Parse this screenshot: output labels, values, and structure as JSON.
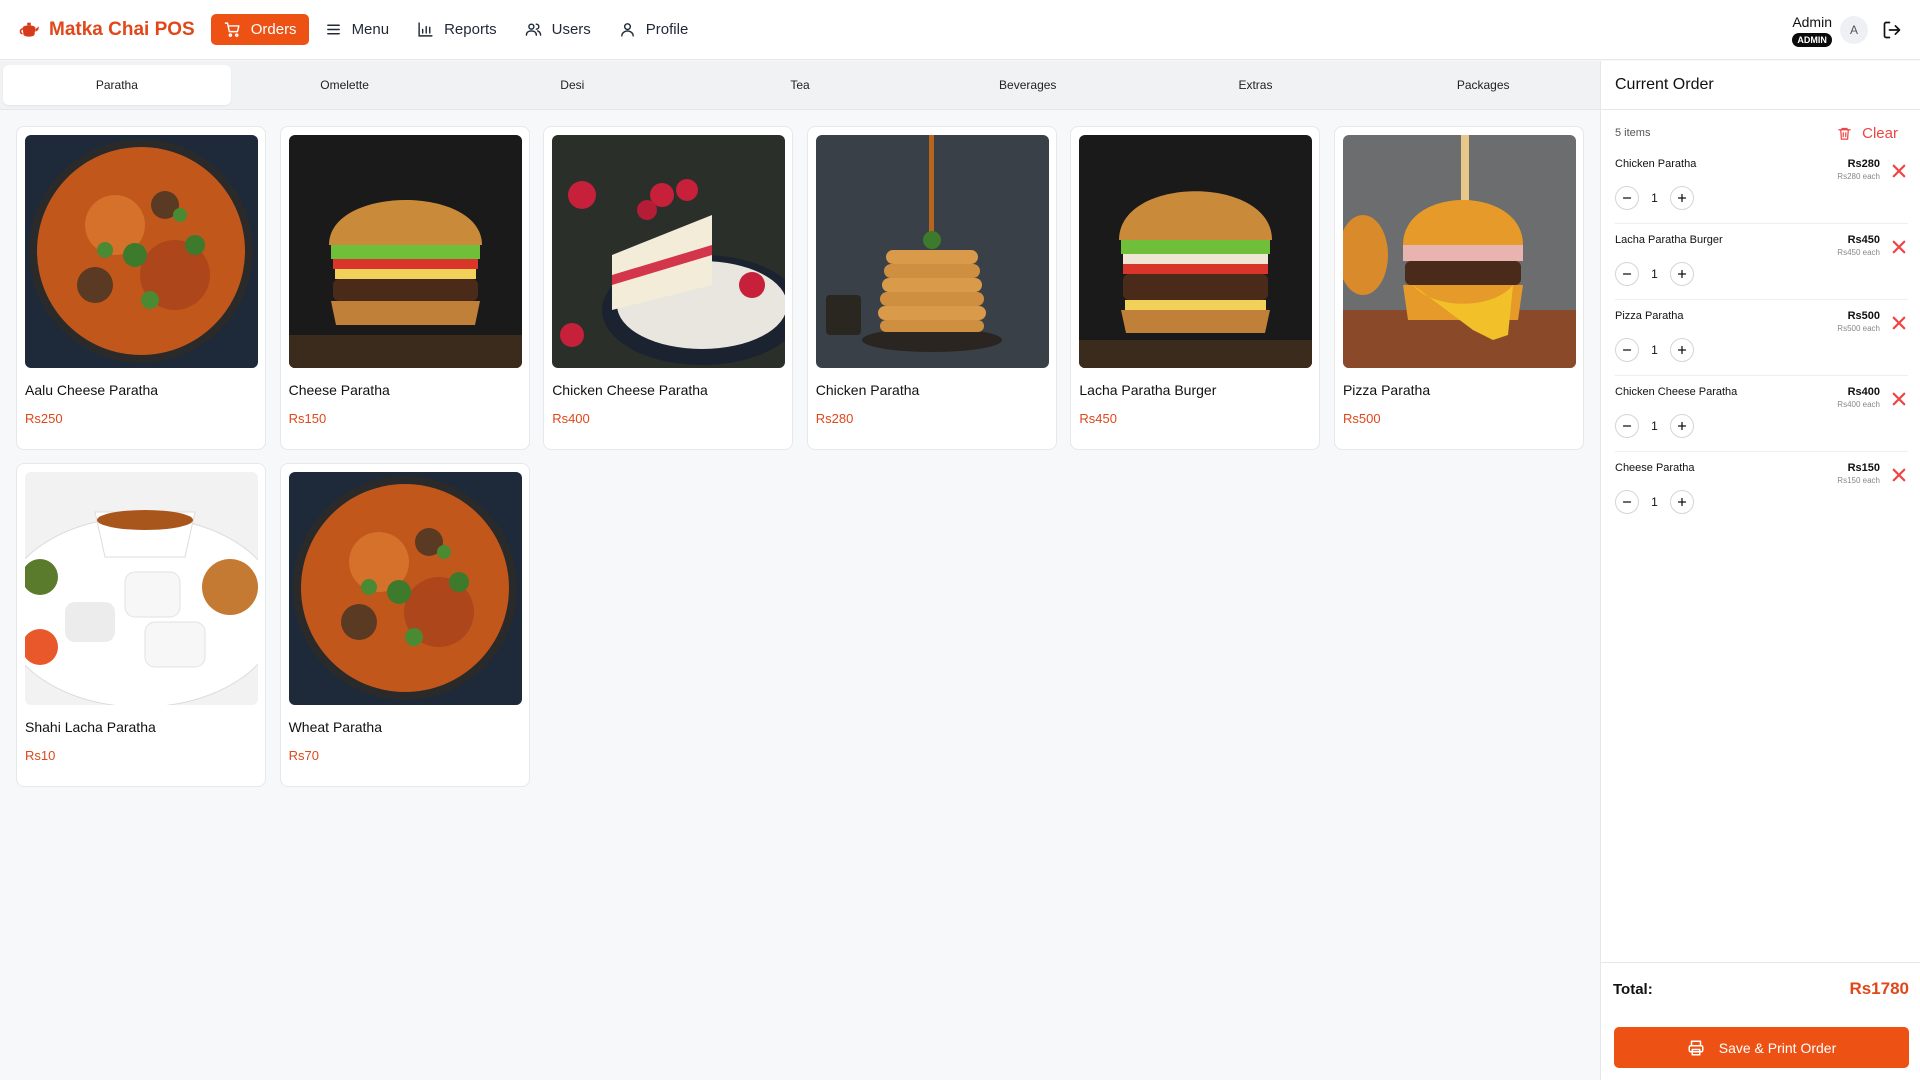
{
  "app": {
    "name": "Matka Chai POS",
    "logo_icon": "teapot-icon",
    "accent_color": "#ed5114"
  },
  "nav": [
    {
      "label": "Orders",
      "icon": "cart-icon",
      "active": true
    },
    {
      "label": "Menu",
      "icon": "menu-icon",
      "active": false
    },
    {
      "label": "Reports",
      "icon": "bar-chart-icon",
      "active": false
    },
    {
      "label": "Users",
      "icon": "users-icon",
      "active": false
    },
    {
      "label": "Profile",
      "icon": "user-icon",
      "active": false
    }
  ],
  "user": {
    "name": "Admin",
    "role_badge": "ADMIN",
    "avatar_initial": "A"
  },
  "categories": [
    {
      "label": "Paratha",
      "active": true
    },
    {
      "label": "Omelette",
      "active": false
    },
    {
      "label": "Desi",
      "active": false
    },
    {
      "label": "Tea",
      "active": false
    },
    {
      "label": "Beverages",
      "active": false
    },
    {
      "label": "Extras",
      "active": false
    },
    {
      "label": "Packages",
      "active": false
    }
  ],
  "products": [
    {
      "name": "Aalu Cheese Paratha",
      "price": "Rs250",
      "image": "curry-pan"
    },
    {
      "name": "Cheese Paratha",
      "price": "Rs150",
      "image": "burger"
    },
    {
      "name": "Chicken Cheese Paratha",
      "price": "Rs400",
      "image": "cake-slice"
    },
    {
      "name": "Chicken Paratha",
      "price": "Rs280",
      "image": "pancakes"
    },
    {
      "name": "Lacha Paratha Burger",
      "price": "Rs450",
      "image": "burger"
    },
    {
      "name": "Pizza Paratha",
      "price": "Rs500",
      "image": "cheese-burger"
    },
    {
      "name": "Shahi Lacha Paratha",
      "price": "Rs10",
      "image": "idli-plate"
    },
    {
      "name": "Wheat Paratha",
      "price": "Rs70",
      "image": "curry-pan"
    }
  ],
  "order": {
    "title": "Current Order",
    "items_count": "5 items",
    "clear_label": "Clear",
    "items": [
      {
        "name": "Chicken Paratha",
        "price": "Rs280",
        "each": "Rs280 each",
        "qty": "1"
      },
      {
        "name": "Lacha Paratha Burger",
        "price": "Rs450",
        "each": "Rs450 each",
        "qty": "1"
      },
      {
        "name": "Pizza Paratha",
        "price": "Rs500",
        "each": "Rs500 each",
        "qty": "1"
      },
      {
        "name": "Chicken Cheese Paratha",
        "price": "Rs400",
        "each": "Rs400 each",
        "qty": "1"
      },
      {
        "name": "Cheese Paratha",
        "price": "Rs150",
        "each": "Rs150 each",
        "qty": "1"
      }
    ],
    "total_label": "Total:",
    "total_value": "Rs1780",
    "save_label": "Save & Print Order"
  }
}
